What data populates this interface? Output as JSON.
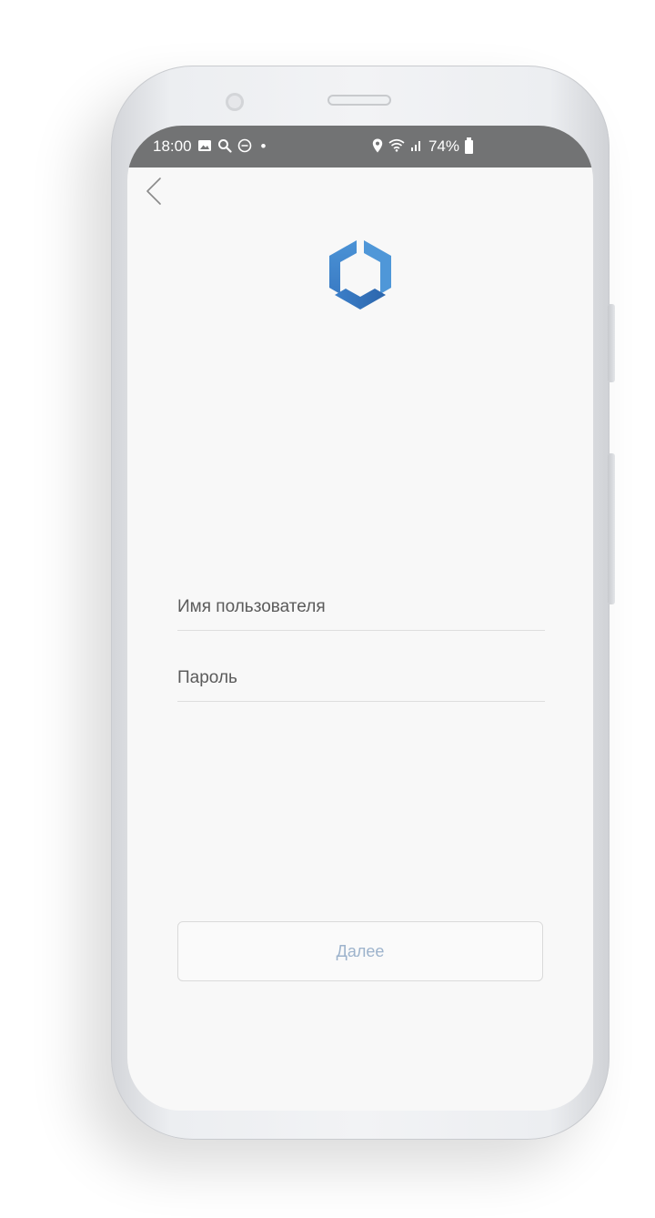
{
  "status_bar": {
    "time": "18:00",
    "dot": "•",
    "battery_percent": "74%",
    "icons_left": [
      "gallery-icon",
      "search-icon",
      "dnd-icon"
    ],
    "icons_right": [
      "location-icon",
      "wifi-icon",
      "signal-icon",
      "battery-icon"
    ]
  },
  "nav": {
    "back_icon": "chevron-left-icon"
  },
  "logo": {
    "icon": "hexagon-logo-icon",
    "color_light": "#5aa0dc",
    "color_dark": "#2f6fb6"
  },
  "form": {
    "username_placeholder": "Имя пользователя",
    "password_placeholder": "Пароль"
  },
  "actions": {
    "next_label": "Далее"
  },
  "colors": {
    "status_bar": "#727374",
    "screen_bg": "#f8f8f8",
    "button_text": "#9db3cc"
  }
}
